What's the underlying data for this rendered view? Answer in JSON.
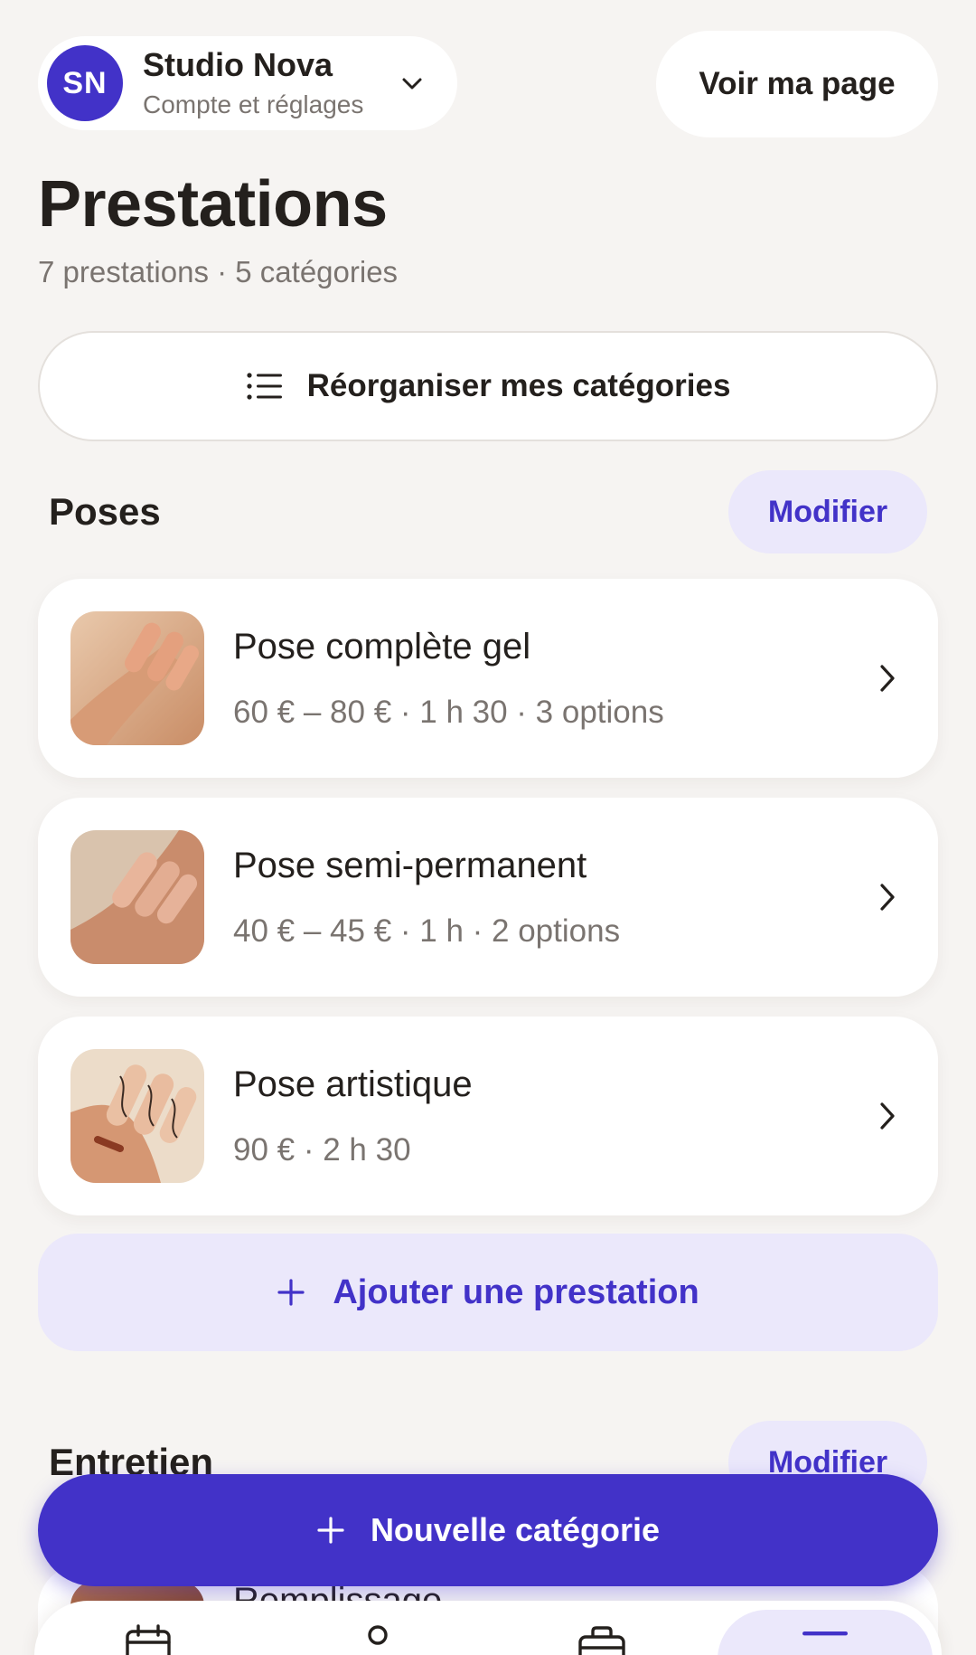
{
  "header": {
    "avatar_initials": "SN",
    "account_name": "Studio Nova",
    "account_subtitle": "Compte et réglages",
    "view_page_label": "Voir ma page"
  },
  "page": {
    "title": "Prestations",
    "subtitle": "7 prestations · 5 catégories",
    "reorganize_label": "Réorganiser mes catégories"
  },
  "sections": [
    {
      "title": "Poses",
      "modify_label": "Modifier",
      "services": [
        {
          "name": "Pose complète gel",
          "meta": "60 € – 80 € · 1 h 30 · 3 options"
        },
        {
          "name": "Pose semi-permanent",
          "meta": "40 € – 45 € · 1 h · 2 options"
        },
        {
          "name": "Pose artistique",
          "meta": "90 € · 2 h 30"
        }
      ],
      "add_label": "Ajouter une prestation"
    },
    {
      "title": "Entretien",
      "modify_label": "Modifier",
      "services": [
        {
          "name": "Remplissage"
        }
      ]
    }
  ],
  "fab": {
    "label": "Nouvelle catégorie"
  },
  "colors": {
    "accent": "#4232c8",
    "accent_soft": "#ebe8fb",
    "background": "#f6f4f2"
  }
}
